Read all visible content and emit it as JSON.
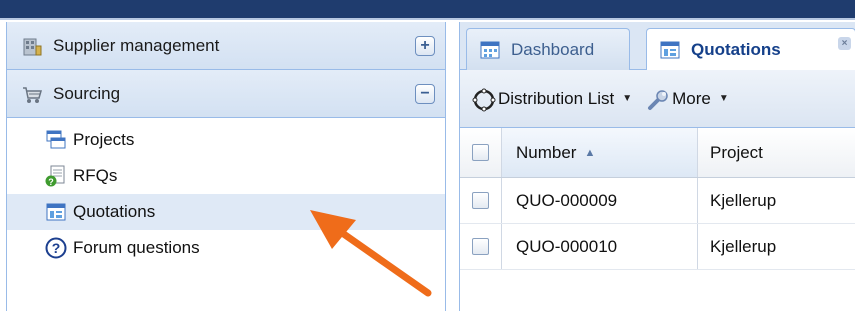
{
  "sidebar": {
    "sections": [
      {
        "label": "Supplier management",
        "icon": "building-icon",
        "toggle": "+"
      },
      {
        "label": "Sourcing",
        "icon": "cart-icon",
        "toggle": "−"
      }
    ],
    "items": [
      {
        "label": "Projects",
        "icon": "projects-icon"
      },
      {
        "label": "RFQs",
        "icon": "rfq-icon"
      },
      {
        "label": "Quotations",
        "icon": "quotations-icon",
        "selected": true
      },
      {
        "label": "Forum questions",
        "icon": "question-icon"
      }
    ]
  },
  "tabs": [
    {
      "label": "Dashboard",
      "icon": "dashboard-icon",
      "active": false
    },
    {
      "label": "Quotations",
      "icon": "quotations-icon",
      "active": true,
      "close": "×"
    }
  ],
  "toolbar": {
    "distribution_label": "Distribution List",
    "more_label": "More",
    "caret": "▼"
  },
  "grid": {
    "columns": [
      "Number",
      "Project"
    ],
    "sort_indicator": "▲",
    "rows": [
      {
        "number": "QUO-000009",
        "project": "Kjellerup"
      },
      {
        "number": "QUO-000010",
        "project": "Kjellerup"
      }
    ]
  },
  "colors": {
    "accent": "#ef6c1a",
    "header_blue": "#1f3c6e",
    "border": "#99bbe8",
    "selected_row": "#dfe9f6"
  }
}
